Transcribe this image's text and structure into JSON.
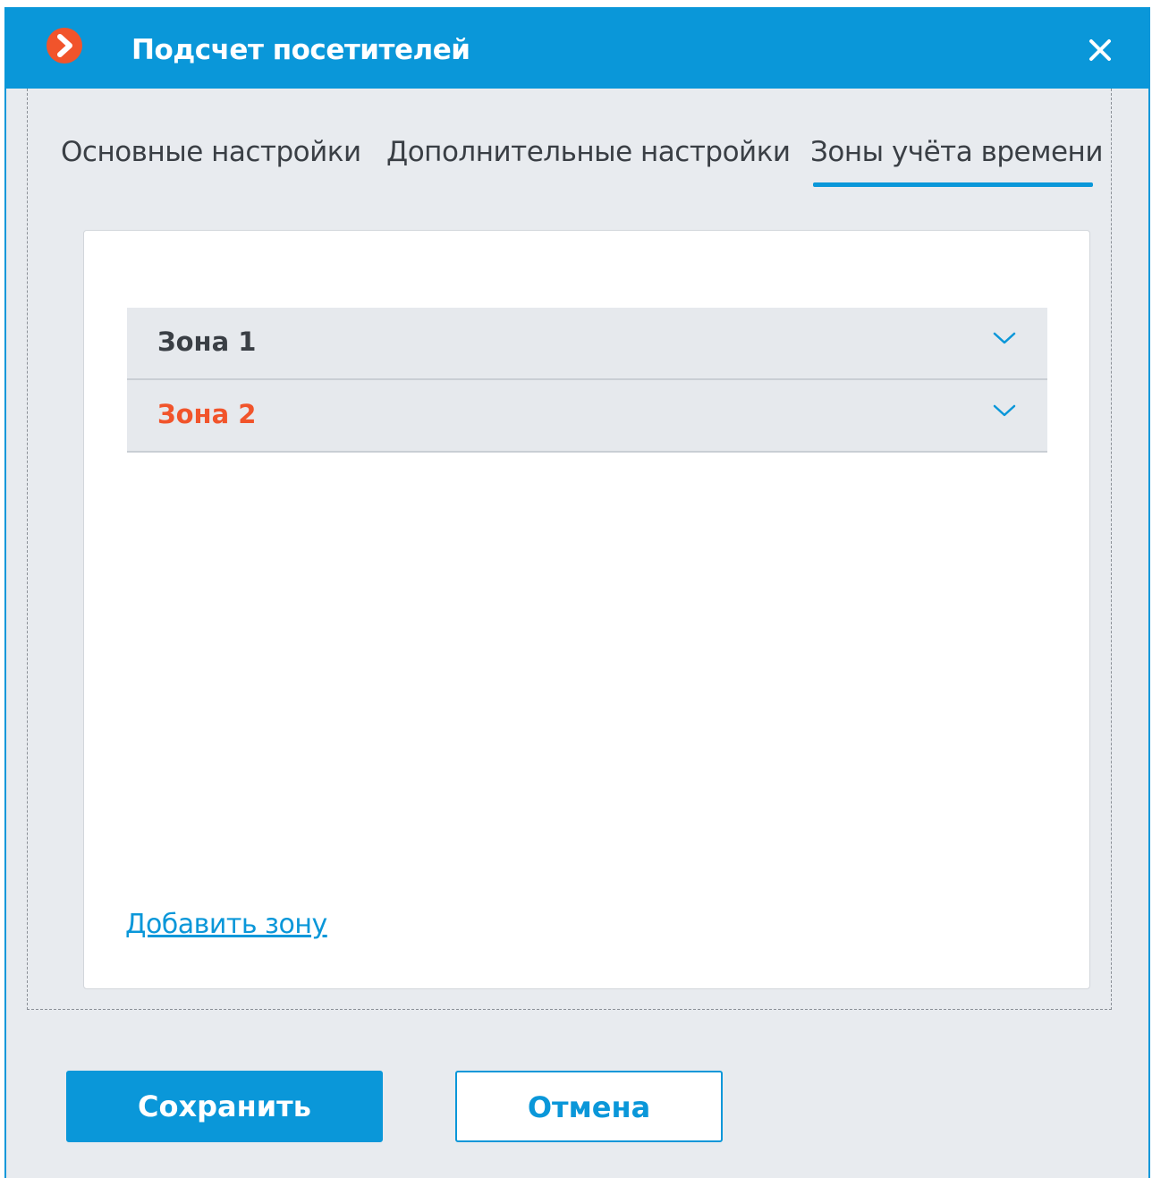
{
  "dialog": {
    "title": "Подсчет посетителей",
    "icon": "app-logo-icon",
    "close_icon": "close-icon"
  },
  "tabs": [
    {
      "label": "Основные настройки",
      "active": false
    },
    {
      "label": "Дополнительные настройки",
      "active": false
    },
    {
      "label": "Зоны учёта времени",
      "active": true
    }
  ],
  "zones": [
    {
      "label": "Зона 1",
      "color": "#3a3f45"
    },
    {
      "label": "Зона 2",
      "color": "#f1542b"
    }
  ],
  "add_zone_label": "Добавить зону",
  "buttons": {
    "save_label": "Сохранить",
    "cancel_label": "Отмена"
  },
  "colors": {
    "accent": "#0a97d9",
    "brand_icon": "#f1542b",
    "error": "#f1542b"
  }
}
